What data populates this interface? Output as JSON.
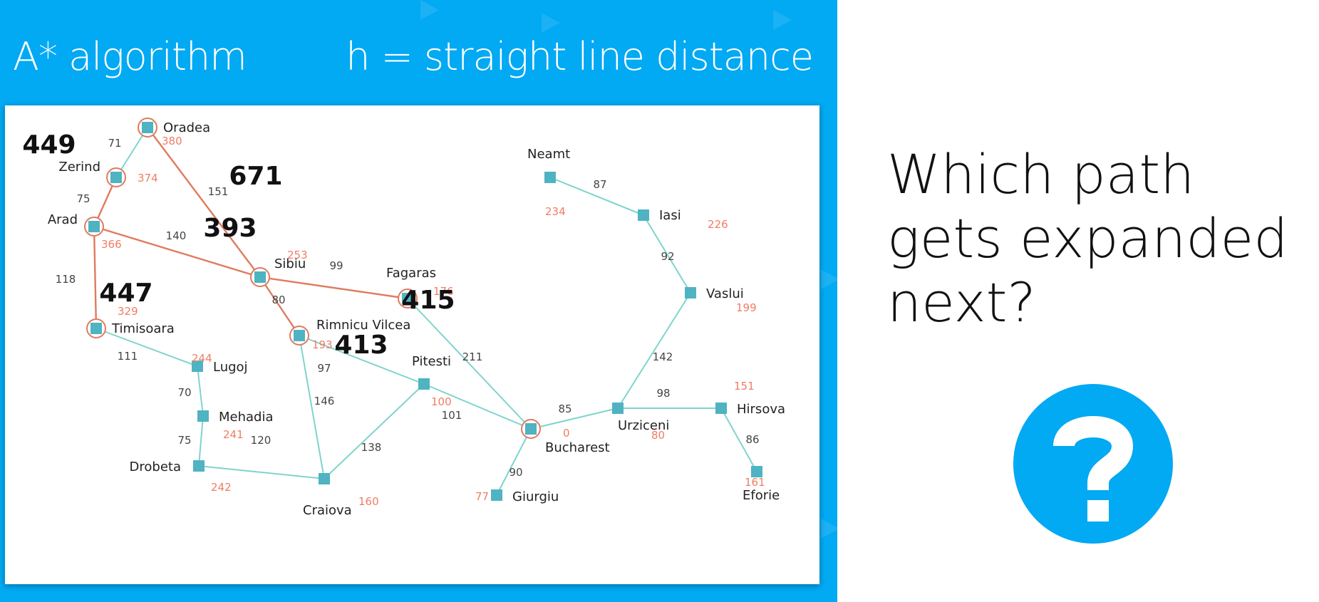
{
  "slide": {
    "title": "A* algorithm",
    "subtitle": "h = straight line distance",
    "question": "Which path gets expanded next?",
    "question_icon": "question-mark-circle-icon"
  },
  "colors": {
    "background_blue": "#02a9f3",
    "node_teal": "#4fb3c2",
    "explored_path": "#e07a5f",
    "unexplored_edge": "#7fd4cc",
    "heuristic_text": "#f07d63",
    "icon_blue": "#02a9f3"
  },
  "map": {
    "cities": [
      {
        "id": "oradea",
        "name": "Oradea",
        "h": "380",
        "circled": true
      },
      {
        "id": "zerind",
        "name": "Zerind",
        "h": "374",
        "circled": true
      },
      {
        "id": "arad",
        "name": "Arad",
        "h": "366",
        "circled": true
      },
      {
        "id": "sibiu",
        "name": "Sibiu",
        "h": "253",
        "circled": true
      },
      {
        "id": "timisoara",
        "name": "Timisoara",
        "h": "329",
        "circled": true
      },
      {
        "id": "fagaras",
        "name": "Fagaras",
        "h": "176",
        "circled": true
      },
      {
        "id": "rimnicu",
        "name": "Rimnicu Vilcea",
        "h": "193",
        "circled": true
      },
      {
        "id": "lugoj",
        "name": "Lugoj",
        "h": "244",
        "circled": false
      },
      {
        "id": "mehadia",
        "name": "Mehadia",
        "h": "241",
        "circled": false
      },
      {
        "id": "drobeta",
        "name": "Drobeta",
        "h": "242",
        "circled": false
      },
      {
        "id": "craiova",
        "name": "Craiova",
        "h": "160",
        "circled": false
      },
      {
        "id": "pitesti",
        "name": "Pitesti",
        "h": "100",
        "circled": false
      },
      {
        "id": "bucharest",
        "name": "Bucharest",
        "h": "0",
        "circled": true
      },
      {
        "id": "giurgiu",
        "name": "Giurgiu",
        "h": "77",
        "circled": false
      },
      {
        "id": "urziceni",
        "name": "Urziceni",
        "h": "80",
        "circled": false
      },
      {
        "id": "hirsova",
        "name": "Hirsova",
        "h": "151",
        "circled": false
      },
      {
        "id": "eforie",
        "name": "Eforie",
        "h": "161",
        "circled": false
      },
      {
        "id": "vaslui",
        "name": "Vaslui",
        "h": "199",
        "circled": false
      },
      {
        "id": "iasi",
        "name": "Iasi",
        "h": "226",
        "circled": false
      },
      {
        "id": "neamt",
        "name": "Neamt",
        "h": "234",
        "circled": false
      }
    ],
    "roads": [
      {
        "from": "oradea",
        "to": "zerind",
        "distance": "71",
        "explored": false
      },
      {
        "from": "zerind",
        "to": "arad",
        "distance": "75",
        "explored": true
      },
      {
        "from": "oradea",
        "to": "sibiu",
        "distance": "151",
        "explored": true
      },
      {
        "from": "arad",
        "to": "sibiu",
        "distance": "140",
        "explored": true
      },
      {
        "from": "arad",
        "to": "timisoara",
        "distance": "118",
        "explored": true
      },
      {
        "from": "sibiu",
        "to": "fagaras",
        "distance": "99",
        "explored": true
      },
      {
        "from": "sibiu",
        "to": "rimnicu",
        "distance": "80",
        "explored": true
      },
      {
        "from": "timisoara",
        "to": "lugoj",
        "distance": "111",
        "explored": false
      },
      {
        "from": "lugoj",
        "to": "mehadia",
        "distance": "70",
        "explored": false
      },
      {
        "from": "mehadia",
        "to": "drobeta",
        "distance": "75",
        "explored": false
      },
      {
        "from": "drobeta",
        "to": "craiova",
        "distance": "120",
        "explored": false
      },
      {
        "from": "rimnicu",
        "to": "craiova",
        "distance": "146",
        "explored": false
      },
      {
        "from": "rimnicu",
        "to": "pitesti",
        "distance": "97",
        "explored": false
      },
      {
        "from": "craiova",
        "to": "pitesti",
        "distance": "138",
        "explored": false
      },
      {
        "from": "fagaras",
        "to": "bucharest",
        "distance": "211",
        "explored": false
      },
      {
        "from": "pitesti",
        "to": "bucharest",
        "distance": "101",
        "explored": false
      },
      {
        "from": "bucharest",
        "to": "giurgiu",
        "distance": "90",
        "explored": false
      },
      {
        "from": "bucharest",
        "to": "urziceni",
        "distance": "85",
        "explored": false
      },
      {
        "from": "urziceni",
        "to": "hirsova",
        "distance": "98",
        "explored": false
      },
      {
        "from": "hirsova",
        "to": "eforie",
        "distance": "86",
        "explored": false
      },
      {
        "from": "urziceni",
        "to": "vaslui",
        "distance": "142",
        "explored": false
      },
      {
        "from": "vaslui",
        "to": "iasi",
        "distance": "92",
        "explored": false
      },
      {
        "from": "iasi",
        "to": "neamt",
        "distance": "87",
        "explored": false
      }
    ],
    "f_costs": [
      {
        "near": "zerind",
        "value": "449"
      },
      {
        "near": "oradea",
        "value": "671"
      },
      {
        "near": "sibiu",
        "value": "393"
      },
      {
        "near": "timisoara",
        "value": "447"
      },
      {
        "near": "fagaras",
        "value": "415"
      },
      {
        "near": "rimnicu",
        "value": "413"
      }
    ]
  }
}
